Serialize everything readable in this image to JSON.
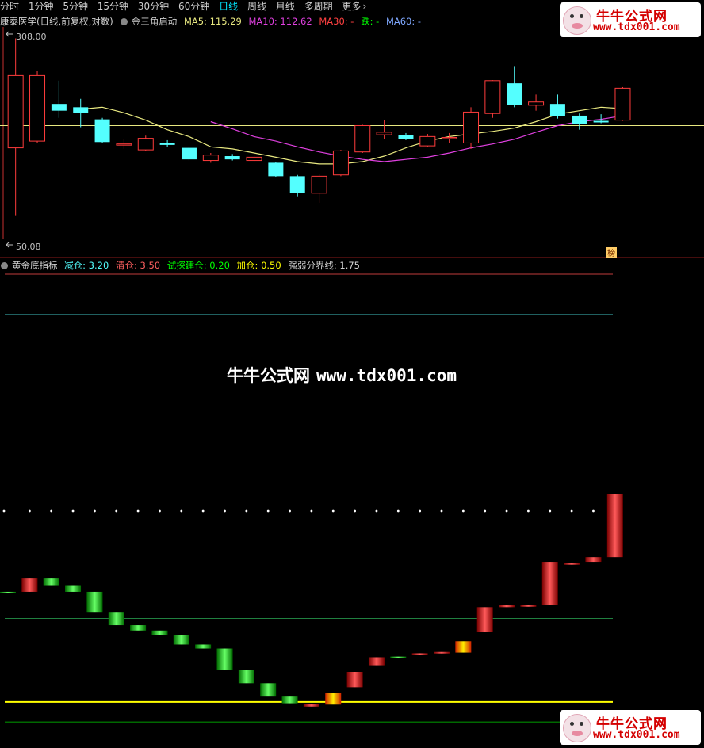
{
  "tabs": [
    "分时",
    "1分钟",
    "5分钟",
    "15分钟",
    "30分钟",
    "60分钟",
    "日线",
    "周线",
    "月线",
    "多周期",
    "更多"
  ],
  "active_tab": "日线",
  "main_legend": {
    "title": "康泰医学(日线,前复权,对数)",
    "formula": "金三角启动",
    "ma5": "MA5: 115.29",
    "ma10": "MA10: 112.62",
    "ma30": "MA30: -",
    "die": "跌: -",
    "ma60": "MA60: -"
  },
  "price_labels": {
    "high": "308.00",
    "low": "50.08",
    "marker": "榜"
  },
  "sub_legend": {
    "name": "黄金底指标",
    "jiancang": "减仓: 3.20",
    "qingcang": "清仓: 3.50",
    "shitan": "试探建仓: 0.20",
    "jiacang": "加仓: 0.50",
    "qiangruo": "强弱分界线: 1.75"
  },
  "watermark": {
    "cn": "牛牛公式网",
    "url": "www.tdx001.com"
  },
  "logo": {
    "line1": "牛牛公式网",
    "line2": "www.tdx001.com"
  },
  "colors": {
    "up": "#ff3c3c",
    "down": "#54ffff",
    "ma5": "#e8e880",
    "ma10": "#e040e0",
    "ma30": "#ff4040",
    "die": "#00ff00",
    "ma60": "#7fa8ff",
    "jiancang": "#54ffff",
    "qingcang": "#ff4040",
    "shitan": "#00ff00",
    "jiacang": "#ffff00"
  },
  "chart_data": [
    {
      "type": "candlestick",
      "candles": [
        {
          "o": 105,
          "c": 210,
          "h": 300,
          "l": 55
        },
        {
          "o": 112,
          "c": 210,
          "h": 220,
          "l": 110
        },
        {
          "o": 160,
          "c": 150,
          "h": 200,
          "l": 140
        },
        {
          "o": 155,
          "c": 147,
          "h": 168,
          "l": 128
        },
        {
          "o": 138,
          "c": 111,
          "h": 140,
          "l": 110
        },
        {
          "o": 109,
          "c": 109,
          "h": 114,
          "l": 104
        },
        {
          "o": 103,
          "c": 115,
          "h": 118,
          "l": 102
        },
        {
          "o": 110,
          "c": 108,
          "h": 113,
          "l": 106
        },
        {
          "o": 105,
          "c": 94,
          "h": 106,
          "l": 93
        },
        {
          "o": 93,
          "c": 98,
          "h": 100,
          "l": 91
        },
        {
          "o": 97,
          "c": 94,
          "h": 99,
          "l": 93
        },
        {
          "o": 93,
          "c": 96,
          "h": 100,
          "l": 92
        },
        {
          "o": 91,
          "c": 80,
          "h": 92,
          "l": 79
        },
        {
          "o": 80,
          "c": 68,
          "h": 81,
          "l": 66
        },
        {
          "o": 68,
          "c": 80,
          "h": 82,
          "l": 62
        },
        {
          "o": 81,
          "c": 102,
          "h": 103,
          "l": 80
        },
        {
          "o": 101,
          "c": 130,
          "h": 131,
          "l": 100
        },
        {
          "o": 119,
          "c": 122,
          "h": 137,
          "l": 114
        },
        {
          "o": 119,
          "c": 114,
          "h": 121,
          "l": 113
        },
        {
          "o": 107,
          "c": 117,
          "h": 120,
          "l": 106
        },
        {
          "o": 115,
          "c": 116,
          "h": 121,
          "l": 110
        },
        {
          "o": 110,
          "c": 148,
          "h": 155,
          "l": 104
        },
        {
          "o": 146,
          "c": 200,
          "h": 201,
          "l": 140
        },
        {
          "o": 195,
          "c": 158,
          "h": 230,
          "l": 155
        },
        {
          "o": 158,
          "c": 163,
          "h": 175,
          "l": 150
        },
        {
          "o": 160,
          "c": 142,
          "h": 175,
          "l": 139
        },
        {
          "o": 143,
          "c": 132,
          "h": 146,
          "l": 125
        },
        {
          "o": 136,
          "c": 134,
          "h": 145,
          "l": 133
        },
        {
          "o": 137,
          "c": 186,
          "h": 188,
          "l": 136
        }
      ],
      "ma5": [
        null,
        null,
        null,
        152,
        155,
        147,
        137,
        125,
        117,
        106,
        104,
        100,
        96,
        92,
        90,
        90,
        92,
        97,
        105,
        112,
        117,
        120,
        123,
        127,
        135,
        145,
        150,
        155,
        153
      ],
      "ma10": [
        null,
        null,
        null,
        null,
        null,
        null,
        null,
        null,
        null,
        135,
        126,
        117,
        112,
        106,
        101,
        97,
        94,
        92,
        94,
        96,
        100,
        105,
        109,
        114,
        122,
        130,
        135,
        138,
        143
      ],
      "ylim": [
        50.08,
        308.0
      ],
      "reference_price": 130
    },
    {
      "type": "bar",
      "name": "黄金底指标",
      "bars": [
        {
          "from": 2.15,
          "to": 2.15,
          "color": "green"
        },
        {
          "from": 2.15,
          "to": 2.35,
          "color": "red"
        },
        {
          "from": 2.35,
          "to": 2.25,
          "color": "green"
        },
        {
          "from": 2.25,
          "to": 2.15,
          "color": "green"
        },
        {
          "from": 2.15,
          "to": 1.85,
          "color": "green"
        },
        {
          "from": 1.85,
          "to": 1.65,
          "color": "green"
        },
        {
          "from": 1.65,
          "to": 1.57,
          "color": "green"
        },
        {
          "from": 1.57,
          "to": 1.5,
          "color": "green"
        },
        {
          "from": 1.5,
          "to": 1.36,
          "color": "green"
        },
        {
          "from": 1.36,
          "to": 1.3,
          "color": "green"
        },
        {
          "from": 1.3,
          "to": 0.98,
          "color": "green"
        },
        {
          "from": 0.98,
          "to": 0.78,
          "color": "green"
        },
        {
          "from": 0.78,
          "to": 0.58,
          "color": "green"
        },
        {
          "from": 0.58,
          "to": 0.48,
          "color": "green"
        },
        {
          "from": 0.47,
          "to": 0.43,
          "color": "red"
        },
        {
          "from": 0.46,
          "to": 0.63,
          "color": "yellow"
        },
        {
          "from": 0.72,
          "to": 0.95,
          "color": "red"
        },
        {
          "from": 1.05,
          "to": 1.17,
          "color": "red"
        },
        {
          "from": 1.18,
          "to": 1.18,
          "color": "green"
        },
        {
          "from": 1.2,
          "to": 1.23,
          "color": "red"
        },
        {
          "from": 1.24,
          "to": 1.25,
          "color": "red"
        },
        {
          "from": 1.24,
          "to": 1.41,
          "color": "yellow"
        },
        {
          "from": 1.55,
          "to": 1.92,
          "color": "red"
        },
        {
          "from": 1.92,
          "to": 1.95,
          "color": "red"
        },
        {
          "from": 1.93,
          "to": 1.95,
          "color": "red"
        },
        {
          "from": 1.95,
          "to": 2.6,
          "color": "red"
        },
        {
          "from": 2.56,
          "to": 2.58,
          "color": "red"
        },
        {
          "from": 2.6,
          "to": 2.67,
          "color": "red"
        },
        {
          "from": 2.67,
          "to": 3.62,
          "color": "red"
        }
      ],
      "dots_value": 3.2,
      "lines": {
        "qingcang": 3.5,
        "jiancang": 3.2,
        "qiangruo": 1.75,
        "jiacang": 0.5,
        "shitan": 0.2
      },
      "ylim": [
        0.0,
        3.8
      ]
    }
  ]
}
